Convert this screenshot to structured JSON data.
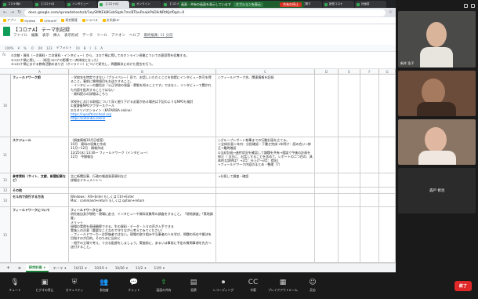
{
  "browser": {
    "tabs": [
      "コロナ禍A",
      "【コロナA】",
      "インタビュー",
      "【コロナA】",
      "オンライン",
      "【コロナA】",
      "研究計画",
      "【コロナA】",
      "研究計画",
      "研究に関す",
      "新型コロナ",
      "計画書"
    ],
    "url": "docs.google.com/spreadsheets/d/1eySMKEkBGsbSqzk7mcBTbuRsejkPaDikNRtKJsf0gd=0",
    "bookmarks": [
      "アプリ",
      "MyWeb",
      "OfficeHP",
      "研究関連",
      "シラバス",
      "文学部HP"
    ],
    "share_notice": "画面 - 共有の画面を表示しています",
    "share_options": "オプションを表示",
    "share_stop": "共有の停止"
  },
  "sheet": {
    "title": "【コロナA】 テーマ別記録",
    "menu": [
      "ファイル",
      "編集",
      "表示",
      "挿入",
      "表示形式",
      "データ",
      "ツール",
      "アドオン",
      "ヘルプ"
    ],
    "last_edit": "最終編集: 11 分前",
    "toolbar": [
      "100%",
      "¥",
      "%",
      ".0",
      ".00",
      "123",
      "デフォルト",
      "10",
      "B",
      "I",
      "S",
      "A"
    ],
    "formula": "①文献・資料（一次資料・二次資料・インタビュー）から、コロナ禍に際してのオンライン授業についての意見等を収集する。\n②コロナ禍に際し ....（新型コロナの影響で一斉休校となった）\n③コロナ禍における教育活動のあり方（オンライン）について研究し、問題解決に向けた提言を行う。",
    "columns": [
      "A",
      "B",
      "C",
      "D",
      "E",
      "F",
      "G",
      "H"
    ]
  },
  "rows": [
    {
      "num": "10",
      "a": "フィールドワーク前",
      "b_red": "・学校名を特定できない（プライバシー）形で、お話しいただくことを前提にインタビュー許可を得ること。事前に質問項目をお送りすること。",
      "b": "・インタビューの趣旨は『公正学校の発展・実態を知ることです』ではなく、インタビューで聞かれた内容を批判することではない\n・資料提示の詳細はこちら\n\n学校外における取組について深く掘り下げる必要がある場合は下記のようなNPOも検討\n①放課後NPOアフタースクール\n②カタリバオンライン（KATARIBA online）",
      "link1": "https://npoafterschool.org",
      "link2": "https://katariba.online",
      "c": "○フィールドワーク先、関連情報を記録"
    },
    {
      "num": "11",
      "a": "スケジュール",
      "b": "（調査情報10月日程案）\n10月　資料の収集と作成\n11月〜12月　情報作成\n12/25(水) 13:30〜 フィールドワーク（インタビュー）\n12月　中間報告",
      "c": "○グループレポート執筆までの行動計画を立てる。\n＜全体計画＞年内：分担確認・下書き完成→年明け：読み合い→修正→最終確認\n①当初計画→進捗状況を確認して課題を共有→相談で今後の計画を修正（ 当日に、お話しすることを含めて、レポートの二つ目の、具体的な説明は？→2月：仕上げ→3月：提出）\n→フィールドワーク内容のまとめ・整理（7）"
    },
    {
      "num": "12",
      "a": "参考資料（サイト、文献、新聞記事など）",
      "b": "主に新聞記事、行政の報道発表資料など\n詳細はドキュメントへ",
      "c": "→分担して調査・確認"
    },
    {
      "num": "13",
      "a": "その他",
      "b": "",
      "c": ""
    },
    {
      "num": "14",
      "a": "セル内で改行する方法",
      "b": "Windows : Alt+Enter もしくは Ctrl+Enter\nMac : command+return もしくは option+return",
      "c": ""
    },
    {
      "num": "15",
      "a": "フィールドワークについて",
      "b_title": "フィールドワークとは",
      "b": "研究者自身が現地・現場に赴き、インタビューや資料収集等の調査をすること。「現地調査」「実地調査」\nメリット\n現場の実際を直接観察できる。生の資料・データ・人々の声が入手できる\n実施上の注意（重要なことなので守りながら考えてみてください）\n・フィールドワーカーは評価者ではない。現場の取り組みや当事者の人を学び、問題の所在や解決を目指すのが目的。そのために出向く\n・相手の立場で考え、十分な配慮をしましょう。実施前に、あるいは事前に予定の質問事項を先方へ送付すること。",
      "c": ""
    }
  ],
  "sheet_tabs": [
    "研究計画",
    "テーマ",
    "10/12",
    "10/19",
    "10/26",
    "11/2",
    "11/9"
  ],
  "participants": [
    {
      "name": "新井 浩子"
    },
    {
      "name": ""
    },
    {
      "name": ""
    },
    {
      "name": "森戸 修治"
    }
  ],
  "zoom": {
    "items": [
      {
        "icon": "mic-icon",
        "glyph": "🎙",
        "label": "ミュート"
      },
      {
        "icon": "video-icon",
        "glyph": "▣",
        "label": "ビデオの停止"
      },
      {
        "icon": "security-icon",
        "glyph": "⛨",
        "label": "セキュリティ"
      },
      {
        "icon": "participants-icon",
        "glyph": "👥",
        "label": "参加者"
      },
      {
        "icon": "chat-icon",
        "glyph": "💬",
        "label": "チャット"
      },
      {
        "icon": "share-icon",
        "glyph": "⇧",
        "label": "画面の共有"
      },
      {
        "icon": "poll-icon",
        "glyph": "▤",
        "label": "投票"
      },
      {
        "icon": "record-icon",
        "glyph": "⏺",
        "label": "レコーディング"
      },
      {
        "icon": "cc-icon",
        "glyph": "CC",
        "label": "字幕"
      },
      {
        "icon": "breakout-icon",
        "glyph": "▦",
        "label": "ブレイクアウトルーム"
      },
      {
        "icon": "reaction-icon",
        "glyph": "☺",
        "label": "反応"
      }
    ],
    "participant_count": "2",
    "leave_label": "終了"
  }
}
